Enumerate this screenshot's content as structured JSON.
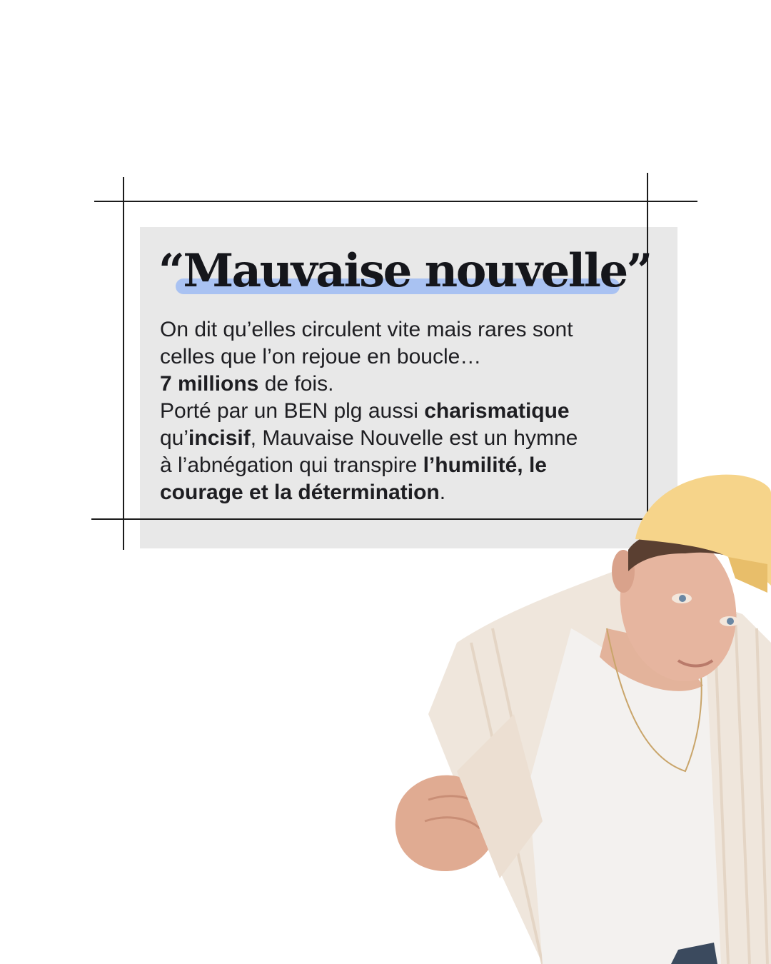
{
  "title": "“Mauvaise nouvelle”",
  "paragraph": {
    "line1": "On dit qu’elles circulent vite mais rares sont",
    "line2": "celles que l’on rejoue en boucle…",
    "line3_bold": "7 millions",
    "line3_rest": " de fois.",
    "line4_start": "Porté par un BEN plg aussi ",
    "line4_bold": "charismatique",
    "line5_start": "qu’",
    "line5_bold": "incisif",
    "line5_rest": ", Mauvaise Nouvelle est un hymne",
    "line6_start": "à l’abnégation qui transpire ",
    "line6_bold": "l’humilité, le",
    "line7_bold": "courage et la détermination",
    "line7_rest": "."
  },
  "colors": {
    "background": "#ffffff",
    "box": "#e8e8e8",
    "highlight": "#a9c2f2",
    "text": "#1e1e22",
    "cap": "#f6d48a"
  }
}
